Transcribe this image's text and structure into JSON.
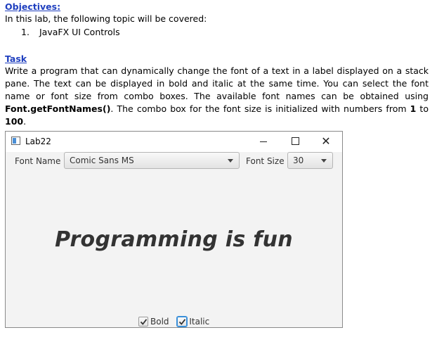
{
  "document": {
    "objectives_heading": "Objectives:",
    "intro": "In this lab, the following topic will be covered:",
    "list_number": "1.",
    "list_item": "JavaFX UI Controls",
    "task_heading": "Task",
    "task_part1": "Write a program that can dynamically change the font of a text in a label displayed on a stack pane. The text can be displayed in bold and italic at the same time. You can select the font name or font size from combo boxes. The available font names can be obtained using ",
    "task_code": "Font.getFontNames()",
    "task_part2": ". The combo box for the font size is initialized with numbers from ",
    "task_num1": "1",
    "task_part3": " to ",
    "task_num2": "100",
    "task_part4": "."
  },
  "window": {
    "title": "Lab22",
    "minimize_glyph": "—",
    "close_glyph": "✕",
    "font_name_label": "Font Name",
    "font_name_value": "Comic Sans MS",
    "font_size_label": "Font Size",
    "font_size_value": "30",
    "display_text": "Programming is fun",
    "bold_label": "Bold",
    "italic_label": "Italic",
    "bold_checked": true,
    "italic_checked": true
  },
  "colors": {
    "heading": "#1f3fbf",
    "focus": "#3a8fd9",
    "window_bg": "#f3f3f3"
  }
}
